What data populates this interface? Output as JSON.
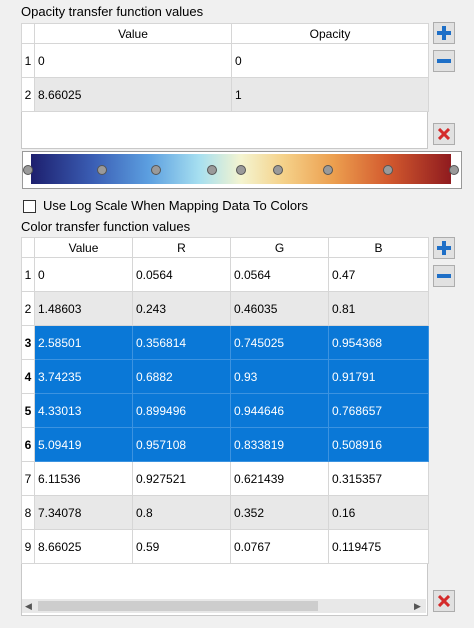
{
  "opacity": {
    "title": "Opacity transfer function values",
    "columns": [
      "Value",
      "Opacity"
    ],
    "rows": [
      {
        "index": "1",
        "value": "0",
        "opacity": "0"
      },
      {
        "index": "2",
        "value": "8.66025",
        "opacity": "1"
      }
    ]
  },
  "log_scale_label": "Use Log Scale When Mapping Data To Colors",
  "log_scale_checked": false,
  "color": {
    "title": "Color transfer function values",
    "columns": [
      "Value",
      "R",
      "G",
      "B"
    ],
    "rows": [
      {
        "index": "1",
        "value": "0",
        "r": "0.0564",
        "g": "0.0564",
        "b": "0.47",
        "selected": false
      },
      {
        "index": "2",
        "value": "1.48603",
        "r": "0.243",
        "g": "0.46035",
        "b": "0.81",
        "selected": false
      },
      {
        "index": "3",
        "value": "2.58501",
        "r": "0.356814",
        "g": "0.745025",
        "b": "0.954368",
        "selected": true
      },
      {
        "index": "4",
        "value": "3.74235",
        "r": "0.6882",
        "g": "0.93",
        "b": "0.91791",
        "selected": true
      },
      {
        "index": "5",
        "value": "4.33013",
        "r": "0.899496",
        "g": "0.944646",
        "b": "0.768657",
        "selected": true
      },
      {
        "index": "6",
        "value": "5.09419",
        "r": "0.957108",
        "g": "0.833819",
        "b": "0.508916",
        "selected": true
      },
      {
        "index": "7",
        "value": "6.11536",
        "r": "0.927521",
        "g": "0.621439",
        "b": "0.315357",
        "selected": false
      },
      {
        "index": "8",
        "value": "7.34078",
        "r": "0.8",
        "g": "0.352",
        "b": "0.16",
        "selected": false
      },
      {
        "index": "9",
        "value": "8.66025",
        "r": "0.59",
        "g": "0.0767",
        "b": "0.119475",
        "selected": false
      }
    ]
  },
  "colors": {
    "selection": "#0a78d7",
    "add_icon": "#1e6fc7",
    "remove_icon": "#1e6fc7",
    "delete_icon": "#d42a2a"
  },
  "icons": {
    "add": "plus-icon",
    "remove": "minus-icon",
    "delete": "x-icon"
  }
}
